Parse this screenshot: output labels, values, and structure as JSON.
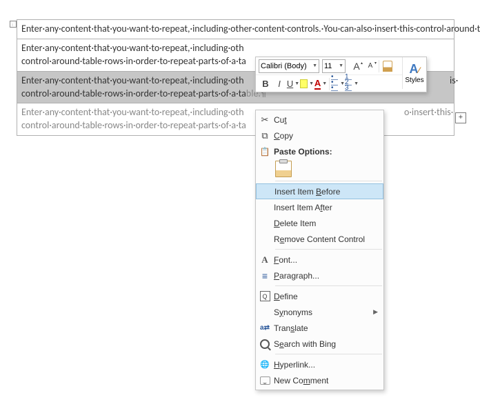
{
  "doc": {
    "cells": [
      "Enter·any·content·that·you·want·to·repeat,·including·other·content·controls.·You·can·also·insert·this·control·around·table·rows·in·order·to·repeat·parts·of·a·table.¶",
      "Enter·any·content·that·you·want·to·repeat,·including·other·content·controls.·You·can·also·insert·this·control·around·table·rows·in·order·to·repeat·parts·of·a·table.¶",
      "Enter·any·content·that·you·want·to·repeat,·including·other·content·controls.·You·can·also·insert·this·control·around·table·rows·in·order·to·repeat·parts·of·a·table.¶",
      "Enter·any·content·that·you·want·to·repeat,·including·other·content·controls.·You·can·also·insert·this·control·around·table·rows·in·order·to·repeat·parts·of·a·table.¶"
    ],
    "cut_prefix": "Enter·any·content·that·you·want·to·repeat,·including·oth",
    "cut_middle": "control·around·table·rows·in·order·to·repeat·parts·of·a·ta",
    "cut_suffix_this": "o·insert·this·",
    "cut_suffix_is": "is·"
  },
  "mini_toolbar": {
    "font": "Calibri (Body)",
    "size": "11",
    "styles_label": "Styles",
    "bold": "B",
    "italic": "I",
    "underline": "U",
    "grow": "A",
    "shrink": "A",
    "font_color": "A"
  },
  "context_menu": {
    "cut": "Cut",
    "copy": "Copy",
    "paste_header": "Paste Options:",
    "insert_before": "Insert Item Before",
    "insert_after": "Insert Item After",
    "delete_item": "Delete Item",
    "remove_cc": "Remove Content Control",
    "font": "Font...",
    "paragraph": "Paragraph...",
    "define": "Define",
    "synonyms": "Synonyms",
    "translate": "Translate",
    "search_bing": "Search with Bing",
    "hyperlink": "Hyperlink...",
    "new_comment": "New Comment"
  }
}
